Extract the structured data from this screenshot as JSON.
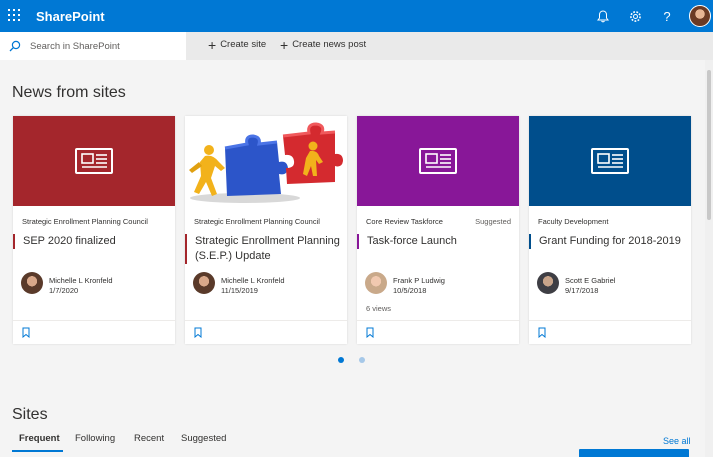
{
  "suitebar": {
    "brand": "SharePoint",
    "icons": [
      "waffle-icon",
      "bell-icon",
      "gear-icon",
      "help-icon"
    ],
    "bg_color": "#0078d4"
  },
  "commandbar": {
    "search_placeholder": "Search in SharePoint",
    "create_site_label": "Create site",
    "create_news_label": "Create news post"
  },
  "news": {
    "heading": "News from sites",
    "cards": [
      {
        "image": "news-icon",
        "image_color": "#a4262c",
        "site": "Strategic Enrollment Planning Council",
        "suggested": "",
        "title": "SEP 2020 finalized",
        "accent": "#a4262c",
        "author": "Michelle L Kronfeld",
        "date": "1/7/2020",
        "views": ""
      },
      {
        "image": "puzzle-image",
        "image_color": "#ffffff",
        "site": "Strategic Enrollment Planning Council",
        "suggested": "",
        "title": "Strategic Enrollment Planning (S.E.P.) Update",
        "accent": "#a4262c",
        "author": "Michelle L Kronfeld",
        "date": "11/15/2019",
        "views": ""
      },
      {
        "image": "news-icon",
        "image_color": "#881798",
        "site": "Core Review Taskforce",
        "suggested": "Suggested",
        "title": "Task-force Launch",
        "accent": "#881798",
        "author": "Frank P Ludwig",
        "date": "10/5/2018",
        "views": "6 views"
      },
      {
        "image": "news-icon",
        "image_color": "#004e8c",
        "site": "Faculty Development",
        "suggested": "",
        "title": "Grant Funding for 2018-2019",
        "accent": "#004e8c",
        "author": "Scott E Gabriel",
        "date": "9/17/2018",
        "views": ""
      }
    ]
  },
  "sites": {
    "heading": "Sites",
    "tabs": [
      "Frequent",
      "Following",
      "Recent",
      "Suggested"
    ],
    "active_tab": "Frequent",
    "see_all": "See all"
  }
}
